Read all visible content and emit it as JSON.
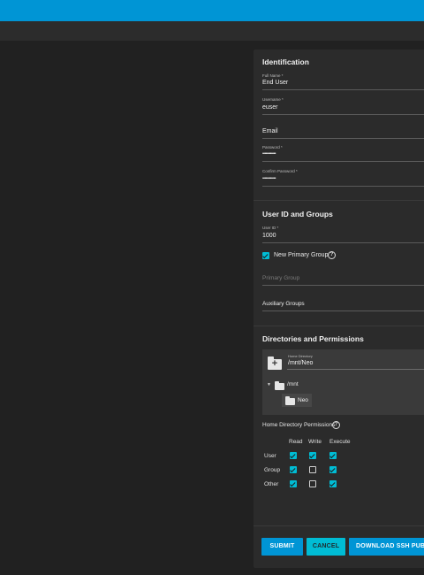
{
  "identification": {
    "title": "Identification",
    "full_name_label": "Full Name *",
    "full_name_value": "End User",
    "username_label": "Username *",
    "username_value": "euser",
    "email_label": "Email",
    "password_label": "Password *",
    "password_value": "••••••••••••",
    "confirm_password_label": "Confirm Password *",
    "confirm_password_value": "••••••••••••"
  },
  "user_groups": {
    "title": "User ID and Groups",
    "user_id_label": "User ID *",
    "user_id_value": "1000",
    "new_primary_group_label": "New Primary Group",
    "new_primary_group_checked": true,
    "primary_group_placeholder": "Primary Group",
    "auxiliary_groups_label": "Auxiliary Groups"
  },
  "directories": {
    "title": "Directories and Permissions",
    "home_directory_label": "Home Directory",
    "home_directory_value": "/mnt/Neo",
    "tree": {
      "root_toggle": "▼",
      "root_label": "/mnt",
      "child_label": "Neo"
    },
    "permissions_label": "Home Directory Permissions",
    "columns": [
      "Read",
      "Write",
      "Execute"
    ],
    "rows": [
      {
        "label": "User",
        "read": true,
        "write": true,
        "execute": true
      },
      {
        "label": "Group",
        "read": true,
        "write": false,
        "execute": true
      },
      {
        "label": "Other",
        "read": true,
        "write": false,
        "execute": true
      }
    ]
  },
  "buttons": {
    "submit": "SUBMIT",
    "cancel": "CANCEL",
    "download": "DOWNLOAD SSH PUB"
  },
  "icons": {
    "help": "?",
    "home_folder_plus": "+"
  },
  "colors": {
    "topbar": "#0095d5",
    "accent": "#00bcd4",
    "submit_bg": "#0095d5",
    "cancel_bg": "#00bcd4"
  }
}
